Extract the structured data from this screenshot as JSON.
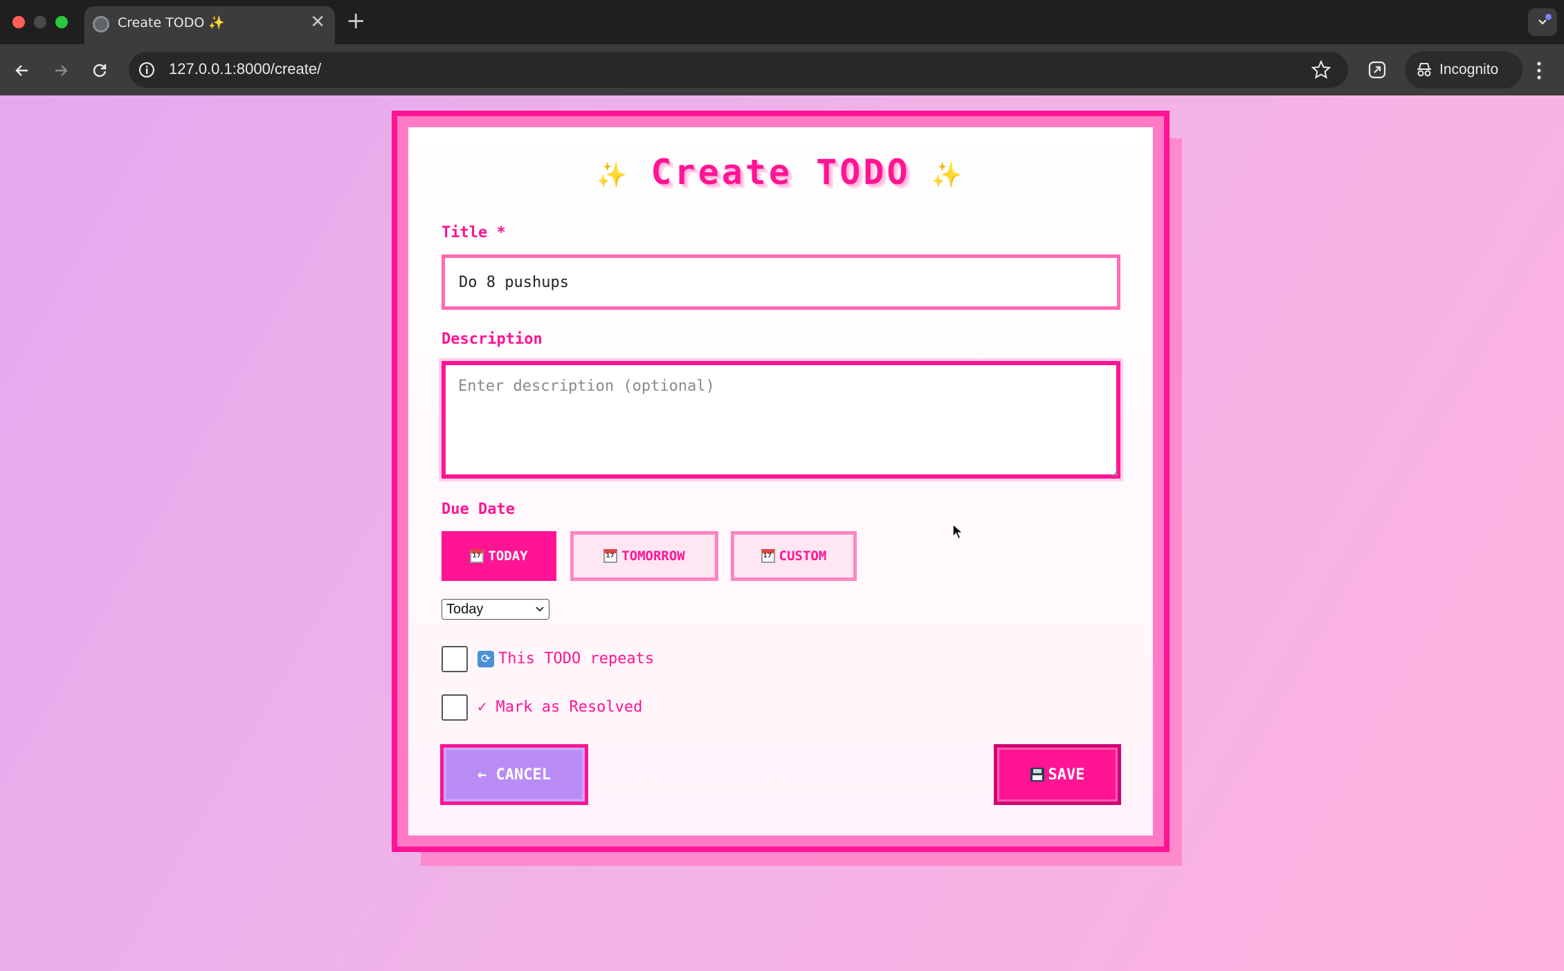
{
  "browser": {
    "tab_title": "Create TODO ✨",
    "tab_close": "✕",
    "new_tab": "+",
    "url": "127.0.0.1:8000/create/",
    "incognito_label": "Incognito"
  },
  "page": {
    "heading": "Create TODO",
    "heading_sparkle": "✨",
    "title_label": "Title *",
    "title_value": "Do 8 pushups",
    "description_label": "Description",
    "description_placeholder": "Enter description (optional)",
    "due_date_label": "Due Date",
    "date_options": [
      {
        "label": "TODAY",
        "active": true
      },
      {
        "label": "TOMORROW",
        "active": false
      },
      {
        "label": "CUSTOM",
        "active": false
      }
    ],
    "due_select_value": "Today",
    "repeat_label": "This TODO repeats",
    "repeat_checked": false,
    "resolved_label": "✓ Mark as Resolved",
    "resolved_checked": false,
    "cancel_label": "← CANCEL",
    "save_label": "SAVE"
  },
  "colors": {
    "accent": "#ff1493",
    "accent_light": "#ff69b4",
    "cancel_bg": "#b98cf5"
  },
  "icons": {
    "tab_favicon": "globe-icon",
    "calendar": "calendar-icon",
    "repeat": "repeat-icon",
    "save": "floppy-disk-icon"
  }
}
